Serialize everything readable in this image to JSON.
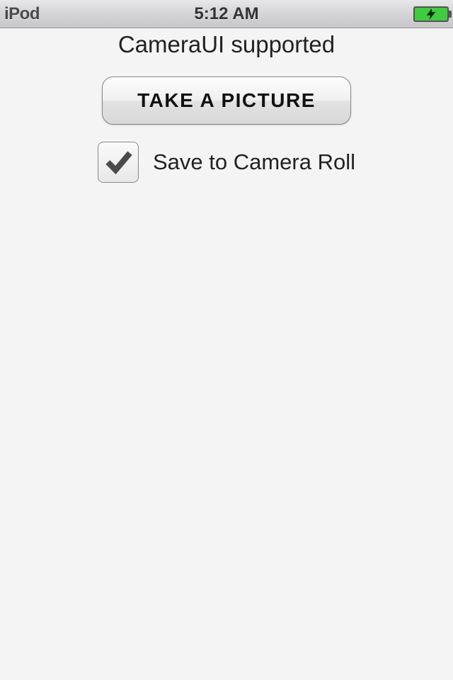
{
  "statusbar": {
    "carrier": "iPod",
    "time": "5:12 AM"
  },
  "main": {
    "title": "CameraUI supported",
    "take_picture_label": "TAKE A PICTURE",
    "save_checkbox": {
      "checked": true,
      "label": "Save to Camera Roll"
    }
  }
}
